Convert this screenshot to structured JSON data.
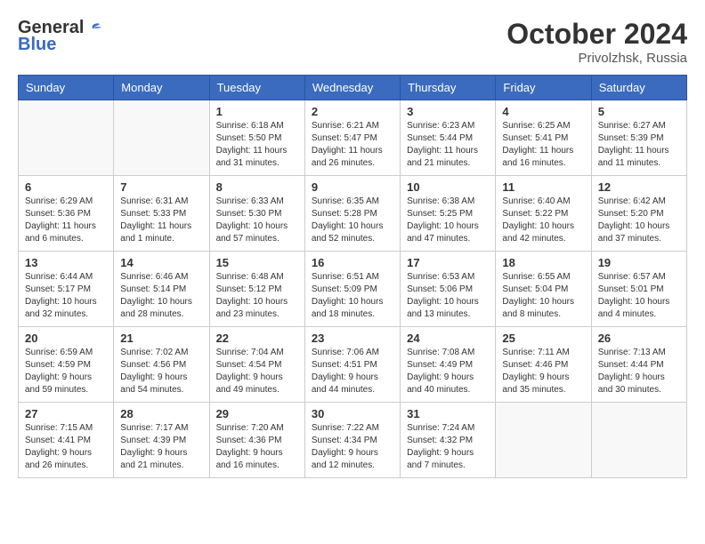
{
  "header": {
    "logo_general": "General",
    "logo_blue": "Blue",
    "month_title": "October 2024",
    "location": "Privolzhsk, Russia"
  },
  "days_of_week": [
    "Sunday",
    "Monday",
    "Tuesday",
    "Wednesday",
    "Thursday",
    "Friday",
    "Saturday"
  ],
  "weeks": [
    [
      {
        "day": "",
        "info": ""
      },
      {
        "day": "",
        "info": ""
      },
      {
        "day": "1",
        "info": "Sunrise: 6:18 AM\nSunset: 5:50 PM\nDaylight: 11 hours and 31 minutes."
      },
      {
        "day": "2",
        "info": "Sunrise: 6:21 AM\nSunset: 5:47 PM\nDaylight: 11 hours and 26 minutes."
      },
      {
        "day": "3",
        "info": "Sunrise: 6:23 AM\nSunset: 5:44 PM\nDaylight: 11 hours and 21 minutes."
      },
      {
        "day": "4",
        "info": "Sunrise: 6:25 AM\nSunset: 5:41 PM\nDaylight: 11 hours and 16 minutes."
      },
      {
        "day": "5",
        "info": "Sunrise: 6:27 AM\nSunset: 5:39 PM\nDaylight: 11 hours and 11 minutes."
      }
    ],
    [
      {
        "day": "6",
        "info": "Sunrise: 6:29 AM\nSunset: 5:36 PM\nDaylight: 11 hours and 6 minutes."
      },
      {
        "day": "7",
        "info": "Sunrise: 6:31 AM\nSunset: 5:33 PM\nDaylight: 11 hours and 1 minute."
      },
      {
        "day": "8",
        "info": "Sunrise: 6:33 AM\nSunset: 5:30 PM\nDaylight: 10 hours and 57 minutes."
      },
      {
        "day": "9",
        "info": "Sunrise: 6:35 AM\nSunset: 5:28 PM\nDaylight: 10 hours and 52 minutes."
      },
      {
        "day": "10",
        "info": "Sunrise: 6:38 AM\nSunset: 5:25 PM\nDaylight: 10 hours and 47 minutes."
      },
      {
        "day": "11",
        "info": "Sunrise: 6:40 AM\nSunset: 5:22 PM\nDaylight: 10 hours and 42 minutes."
      },
      {
        "day": "12",
        "info": "Sunrise: 6:42 AM\nSunset: 5:20 PM\nDaylight: 10 hours and 37 minutes."
      }
    ],
    [
      {
        "day": "13",
        "info": "Sunrise: 6:44 AM\nSunset: 5:17 PM\nDaylight: 10 hours and 32 minutes."
      },
      {
        "day": "14",
        "info": "Sunrise: 6:46 AM\nSunset: 5:14 PM\nDaylight: 10 hours and 28 minutes."
      },
      {
        "day": "15",
        "info": "Sunrise: 6:48 AM\nSunset: 5:12 PM\nDaylight: 10 hours and 23 minutes."
      },
      {
        "day": "16",
        "info": "Sunrise: 6:51 AM\nSunset: 5:09 PM\nDaylight: 10 hours and 18 minutes."
      },
      {
        "day": "17",
        "info": "Sunrise: 6:53 AM\nSunset: 5:06 PM\nDaylight: 10 hours and 13 minutes."
      },
      {
        "day": "18",
        "info": "Sunrise: 6:55 AM\nSunset: 5:04 PM\nDaylight: 10 hours and 8 minutes."
      },
      {
        "day": "19",
        "info": "Sunrise: 6:57 AM\nSunset: 5:01 PM\nDaylight: 10 hours and 4 minutes."
      }
    ],
    [
      {
        "day": "20",
        "info": "Sunrise: 6:59 AM\nSunset: 4:59 PM\nDaylight: 9 hours and 59 minutes."
      },
      {
        "day": "21",
        "info": "Sunrise: 7:02 AM\nSunset: 4:56 PM\nDaylight: 9 hours and 54 minutes."
      },
      {
        "day": "22",
        "info": "Sunrise: 7:04 AM\nSunset: 4:54 PM\nDaylight: 9 hours and 49 minutes."
      },
      {
        "day": "23",
        "info": "Sunrise: 7:06 AM\nSunset: 4:51 PM\nDaylight: 9 hours and 44 minutes."
      },
      {
        "day": "24",
        "info": "Sunrise: 7:08 AM\nSunset: 4:49 PM\nDaylight: 9 hours and 40 minutes."
      },
      {
        "day": "25",
        "info": "Sunrise: 7:11 AM\nSunset: 4:46 PM\nDaylight: 9 hours and 35 minutes."
      },
      {
        "day": "26",
        "info": "Sunrise: 7:13 AM\nSunset: 4:44 PM\nDaylight: 9 hours and 30 minutes."
      }
    ],
    [
      {
        "day": "27",
        "info": "Sunrise: 7:15 AM\nSunset: 4:41 PM\nDaylight: 9 hours and 26 minutes."
      },
      {
        "day": "28",
        "info": "Sunrise: 7:17 AM\nSunset: 4:39 PM\nDaylight: 9 hours and 21 minutes."
      },
      {
        "day": "29",
        "info": "Sunrise: 7:20 AM\nSunset: 4:36 PM\nDaylight: 9 hours and 16 minutes."
      },
      {
        "day": "30",
        "info": "Sunrise: 7:22 AM\nSunset: 4:34 PM\nDaylight: 9 hours and 12 minutes."
      },
      {
        "day": "31",
        "info": "Sunrise: 7:24 AM\nSunset: 4:32 PM\nDaylight: 9 hours and 7 minutes."
      },
      {
        "day": "",
        "info": ""
      },
      {
        "day": "",
        "info": ""
      }
    ]
  ]
}
